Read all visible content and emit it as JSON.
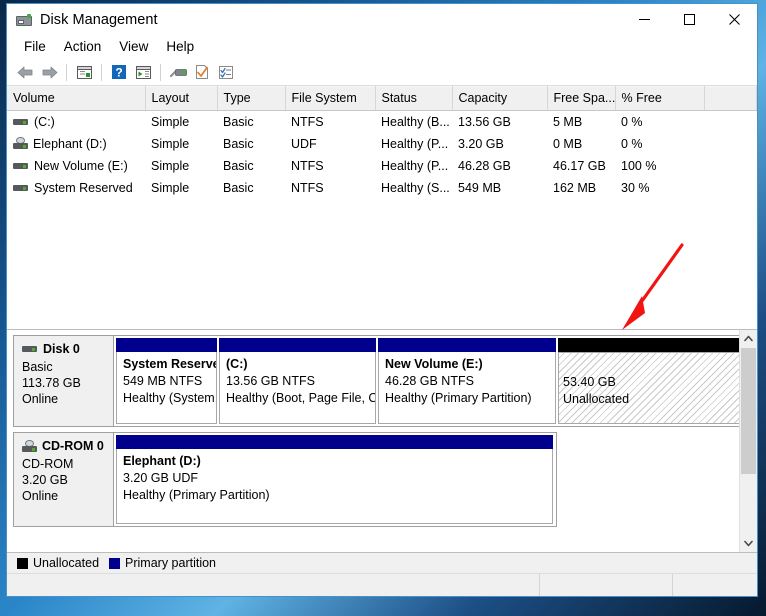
{
  "window": {
    "title": "Disk Management",
    "icon": "disk-drive-icon",
    "buttons": {
      "minimize": "—",
      "maximize": "□",
      "close": "✕"
    }
  },
  "menu": {
    "items": [
      "File",
      "Action",
      "View",
      "Help"
    ]
  },
  "toolbar": {
    "items": [
      {
        "name": "back-button",
        "icon": "left-arrow-icon"
      },
      {
        "name": "forward-button",
        "icon": "right-arrow-icon"
      },
      {
        "name": "show-hide-console-tree-button",
        "icon": "console-tree-icon"
      },
      {
        "name": "help-button",
        "icon": "question-mark-icon"
      },
      {
        "name": "show-hide-action-pane-button",
        "icon": "action-pane-icon"
      },
      {
        "name": "rescan-disks-button",
        "icon": "disk-rescan-icon"
      },
      {
        "name": "properties-button",
        "icon": "checkmark-page-icon"
      },
      {
        "name": "refresh-button",
        "icon": "list-check-icon"
      }
    ]
  },
  "volume_list": {
    "columns": [
      "Volume",
      "Layout",
      "Type",
      "File System",
      "Status",
      "Capacity",
      "Free Spa...",
      "% Free",
      ""
    ],
    "rows": [
      {
        "icon": "hard-disk-icon",
        "volume": "(C:)",
        "layout": "Simple",
        "type": "Basic",
        "file_system": "NTFS",
        "status": "Healthy (B...",
        "capacity": "13.56 GB",
        "free_space": "5 MB",
        "percent_free": "0 %"
      },
      {
        "icon": "cdrom-icon",
        "volume": "Elephant (D:)",
        "layout": "Simple",
        "type": "Basic",
        "file_system": "UDF",
        "status": "Healthy (P...",
        "capacity": "3.20 GB",
        "free_space": "0 MB",
        "percent_free": "0 %"
      },
      {
        "icon": "hard-disk-icon",
        "volume": "New Volume (E:)",
        "layout": "Simple",
        "type": "Basic",
        "file_system": "NTFS",
        "status": "Healthy (P...",
        "capacity": "46.28 GB",
        "free_space": "46.17 GB",
        "percent_free": "100 %"
      },
      {
        "icon": "hard-disk-icon",
        "volume": "System Reserved",
        "layout": "Simple",
        "type": "Basic",
        "file_system": "NTFS",
        "status": "Healthy (S...",
        "capacity": "549 MB",
        "free_space": "162 MB",
        "percent_free": "30 %"
      }
    ]
  },
  "disk_map": {
    "disks": [
      {
        "icon": "hard-disk-icon",
        "name": "Disk 0",
        "type": "Basic",
        "size": "113.78 GB",
        "status": "Online",
        "partitions": [
          {
            "kind": "primary",
            "line1": "System Reserve",
            "line2": "549 MB NTFS",
            "line3": "Healthy (System,"
          },
          {
            "kind": "primary",
            "line1": "(C:)",
            "line2": "13.56 GB NTFS",
            "line3": "Healthy (Boot, Page File, Cr"
          },
          {
            "kind": "primary",
            "line1": "New Volume  (E:)",
            "line2": "46.28 GB NTFS",
            "line3": "Healthy (Primary Partition)"
          },
          {
            "kind": "unallocated",
            "line1": "53.40 GB",
            "line2": "Unallocated",
            "line3": ""
          }
        ]
      },
      {
        "icon": "cdrom-icon",
        "name": "CD-ROM 0",
        "type": "CD-ROM",
        "size": "3.20 GB",
        "status": "Online",
        "partitions": [
          {
            "kind": "primary",
            "line1": "Elephant  (D:)",
            "line2": "3.20 GB UDF",
            "line3": "Healthy (Primary Partition)"
          }
        ]
      }
    ]
  },
  "legend": {
    "items": [
      {
        "label": "Unallocated",
        "color": "#000000"
      },
      {
        "label": "Primary partition",
        "color": "#00008c"
      }
    ]
  },
  "annotation": {
    "shape": "red-arrow",
    "color": "#f21313",
    "points_to": "unallocated-space-block"
  },
  "statusbar": {
    "panels": [
      "",
      "",
      ""
    ]
  }
}
